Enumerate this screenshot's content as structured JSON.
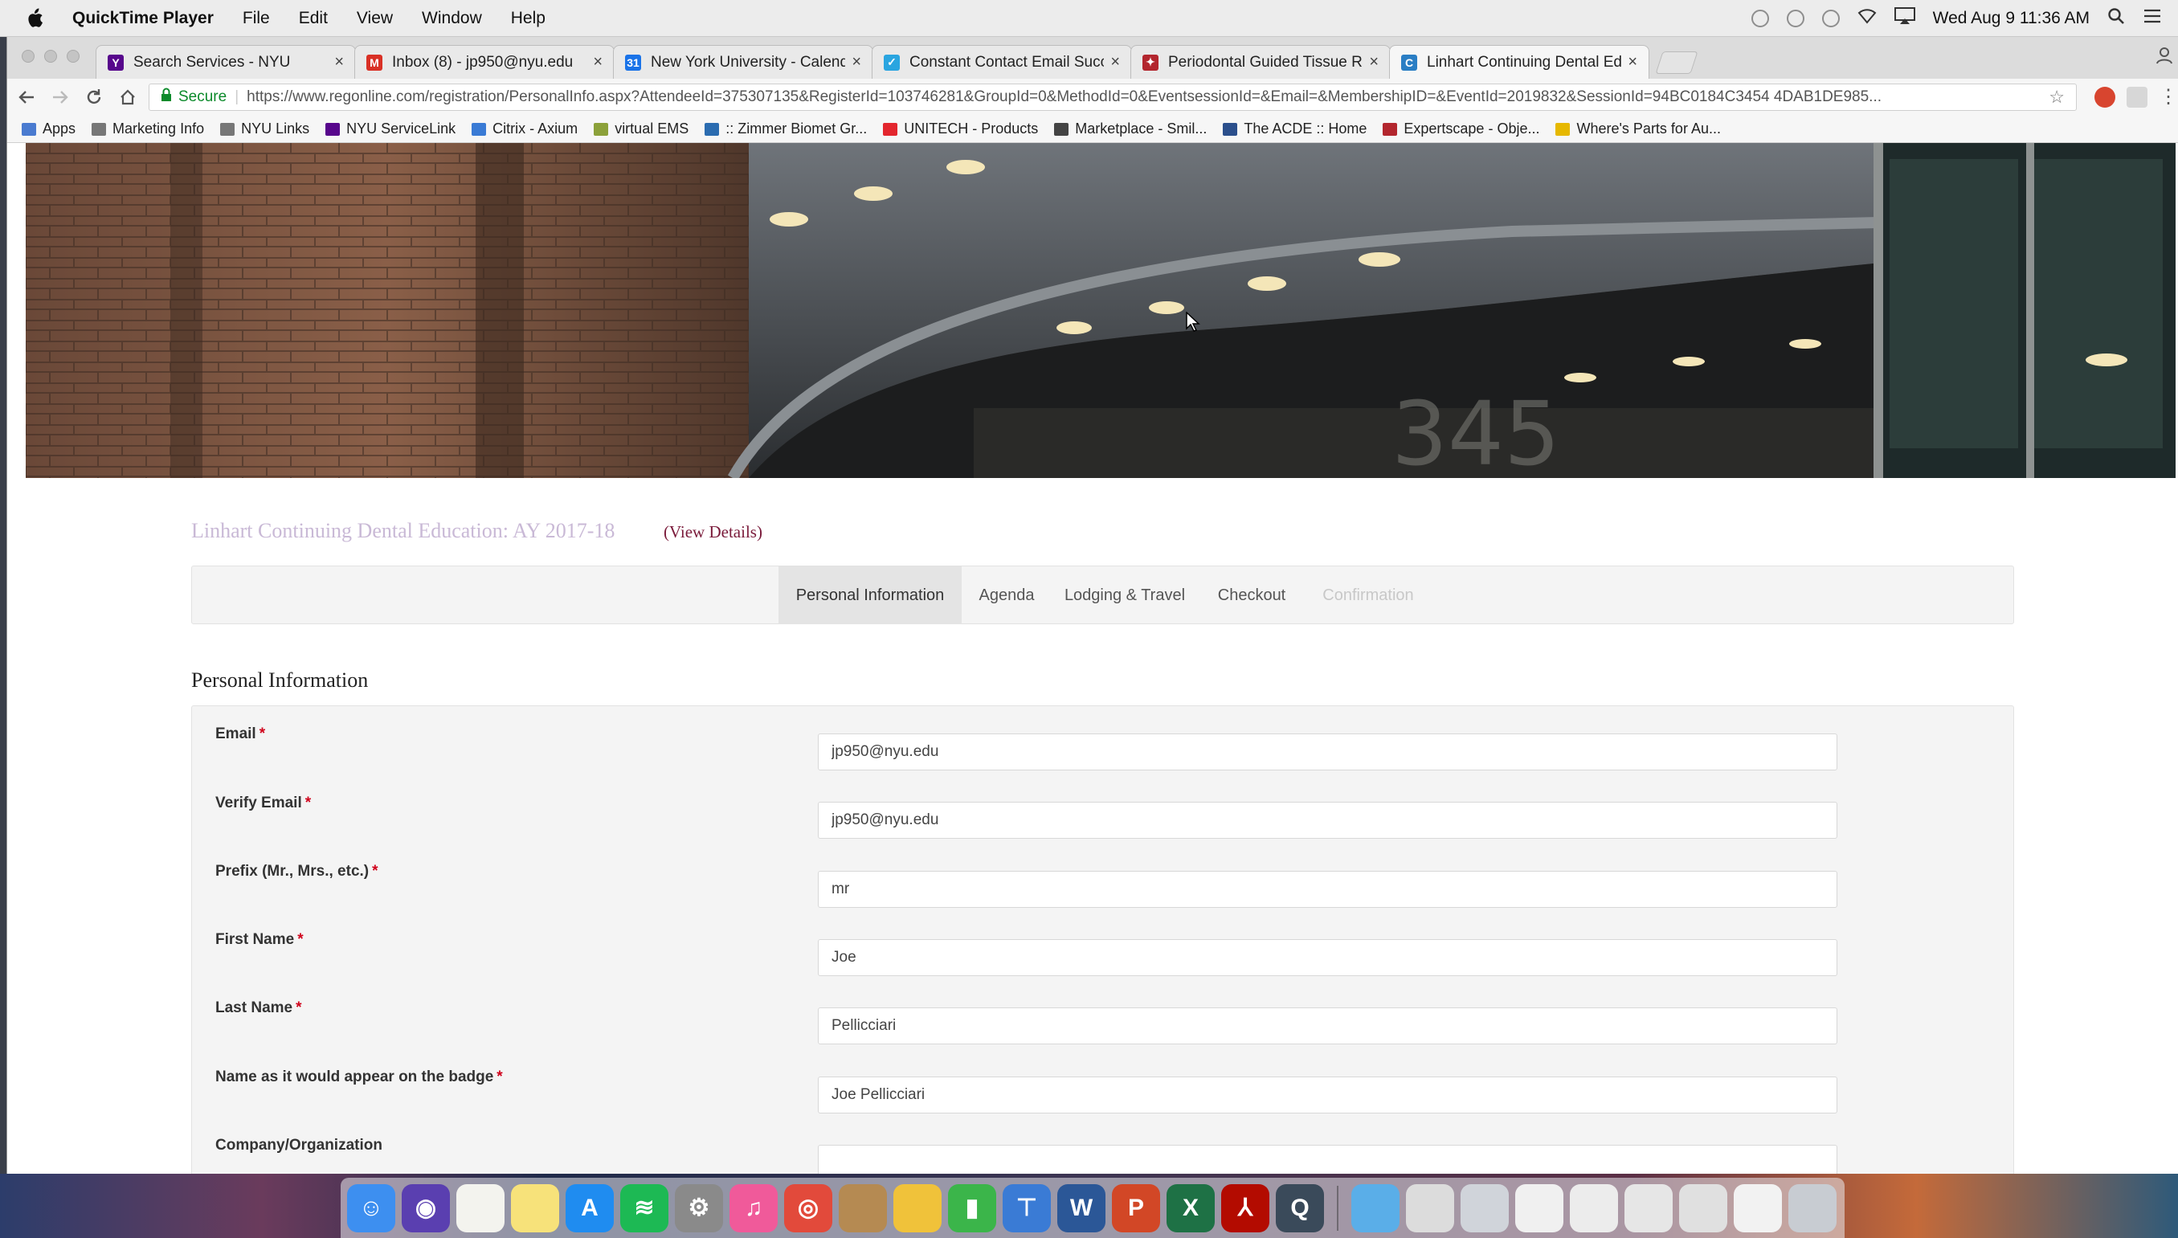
{
  "menubar": {
    "app_name": "QuickTime Player",
    "items": [
      "File",
      "Edit",
      "View",
      "Window",
      "Help"
    ],
    "clock": "Wed Aug 9  11:36 AM"
  },
  "tabs": [
    {
      "title": "Search Services - NYU",
      "icon": "nyu-icon",
      "color": "#57068c",
      "glyph": "Y"
    },
    {
      "title": "Inbox (8) - jp950@nyu.edu",
      "icon": "gmail-icon",
      "color": "#d93025",
      "glyph": "M"
    },
    {
      "title": "New York University - Calendar",
      "icon": "calendar-icon",
      "color": "#1a73e8",
      "glyph": "31"
    },
    {
      "title": "Constant Contact Email Success",
      "icon": "constant-contact-icon",
      "color": "#2aa5e0",
      "glyph": "✓"
    },
    {
      "title": "Periodontal Guided Tissue Regeneration",
      "icon": "event-icon",
      "color": "#b3262e",
      "glyph": "✦"
    },
    {
      "title": "Linhart Continuing Dental Education",
      "icon": "regonline-icon",
      "color": "#2a7ec4",
      "glyph": "C",
      "active": true
    }
  ],
  "address_bar": {
    "secure_label": "Secure",
    "url": "https://www.regonline.com/registration/PersonalInfo.aspx?AttendeeId=375307135&RegisterId=103746281&GroupId=0&MethodId=0&EventsessionId=&Email=&MembershipID=&EventId=2019832&SessionId=94BC0184C3454 4DAB1DE985..."
  },
  "bookmarks": [
    {
      "label": "Apps",
      "icon": "apps-grid-icon",
      "color": "#4a7bd0"
    },
    {
      "label": "Marketing Info",
      "icon": "folder-icon",
      "color": "#777777"
    },
    {
      "label": "NYU Links",
      "icon": "folder-icon",
      "color": "#777777"
    },
    {
      "label": "NYU ServiceLink",
      "icon": "nyu-icon",
      "color": "#57068c"
    },
    {
      "label": "Citrix - Axium",
      "icon": "citrix-icon",
      "color": "#3a7bd5"
    },
    {
      "label": "virtual EMS",
      "icon": "ems-icon",
      "color": "#8ca13a"
    },
    {
      "label": ":: Zimmer Biomet Gr...",
      "icon": "zimmer-icon",
      "color": "#2b6cb0"
    },
    {
      "label": "UNITECH - Products",
      "icon": "unitech-icon",
      "color": "#e3262e"
    },
    {
      "label": "Marketplace - Smil...",
      "icon": "marketplace-icon",
      "color": "#444444"
    },
    {
      "label": "The ACDE :: Home",
      "icon": "acde-icon",
      "color": "#2b4f8c"
    },
    {
      "label": "Expertscape - Obje...",
      "icon": "expertscape-icon",
      "color": "#b3262e"
    },
    {
      "label": "Where's Parts for Au...",
      "icon": "folder-icon",
      "color": "#e6b800"
    }
  ],
  "page": {
    "event_title": "Linhart Continuing Dental Education: AY 2017-18",
    "view_details": "(View Details)",
    "steps": [
      {
        "label": "Personal Information",
        "state": "active"
      },
      {
        "label": "Agenda",
        "state": "normal"
      },
      {
        "label": "Lodging & Travel",
        "state": "normal"
      },
      {
        "label": "Checkout",
        "state": "normal"
      },
      {
        "label": "Confirmation",
        "state": "disabled"
      }
    ],
    "section_title": "Personal Information",
    "required_mark": "*",
    "fields": [
      {
        "label": "Email",
        "required": true,
        "value": "jp950@nyu.edu"
      },
      {
        "label": "Verify Email",
        "required": true,
        "value": "jp950@nyu.edu"
      },
      {
        "label": "Prefix (Mr., Mrs., etc.)",
        "required": true,
        "value": "mr"
      },
      {
        "label": "First Name",
        "required": true,
        "value": "Joe"
      },
      {
        "label": "Last Name",
        "required": true,
        "value": "Pellicciari"
      },
      {
        "label": "Name as it would appear on the badge",
        "required": true,
        "value": "Joe Pellicciari"
      },
      {
        "label": "Company/Organization",
        "required": false,
        "value": ""
      }
    ]
  },
  "dock": [
    {
      "name": "finder-icon",
      "color": "#3d8ff0",
      "glyph": "☺"
    },
    {
      "name": "siri-icon",
      "color": "#5a3fb0",
      "glyph": "◉"
    },
    {
      "name": "notes-icon",
      "color": "#f3f3ee",
      "glyph": ""
    },
    {
      "name": "stickies-icon",
      "color": "#f7e27a",
      "glyph": ""
    },
    {
      "name": "app-store-icon",
      "color": "#1f8cf0",
      "glyph": "A"
    },
    {
      "name": "spotify-icon",
      "color": "#1db954",
      "glyph": "≋"
    },
    {
      "name": "system-preferences-icon",
      "color": "#8a8a8a",
      "glyph": "⚙"
    },
    {
      "name": "itunes-icon",
      "color": "#f05a9a",
      "glyph": "♫"
    },
    {
      "name": "chrome-icon",
      "color": "#e24a3b",
      "glyph": "◎"
    },
    {
      "name": "contacts-icon",
      "color": "#b58a52",
      "glyph": ""
    },
    {
      "name": "keynote-icon",
      "color": "#f0c23a",
      "glyph": ""
    },
    {
      "name": "numbers-icon",
      "color": "#3bb54a",
      "glyph": "▮"
    },
    {
      "name": "keynote-2-icon",
      "color": "#3a7bd5",
      "glyph": "⊤"
    },
    {
      "name": "word-icon",
      "color": "#2b5797",
      "glyph": "W"
    },
    {
      "name": "powerpoint-icon",
      "color": "#d24726",
      "glyph": "P"
    },
    {
      "name": "excel-icon",
      "color": "#1e7145",
      "glyph": "X"
    },
    {
      "name": "acrobat-icon",
      "color": "#b30b00",
      "glyph": "⅄"
    },
    {
      "name": "quicktime-icon",
      "color": "#3a4a5a",
      "glyph": "Q"
    },
    {
      "name": "downloads-folder-icon",
      "color": "#5aaee8",
      "glyph": ""
    },
    {
      "name": "document-stack-icon",
      "color": "#dcdcdc",
      "glyph": ""
    },
    {
      "name": "screenshot-stack-icon",
      "color": "#d0d4da",
      "glyph": ""
    },
    {
      "name": "document-icon",
      "color": "#f0f0f0",
      "glyph": ""
    },
    {
      "name": "spreadsheet-icon",
      "color": "#ececec",
      "glyph": ""
    },
    {
      "name": "file-icon",
      "color": "#e6e6e6",
      "glyph": ""
    },
    {
      "name": "file-2-icon",
      "color": "#e0e0e0",
      "glyph": ""
    },
    {
      "name": "file-3-icon",
      "color": "#f2f2f2",
      "glyph": ""
    },
    {
      "name": "trash-icon",
      "color": "#c8ccd2",
      "glyph": ""
    }
  ]
}
